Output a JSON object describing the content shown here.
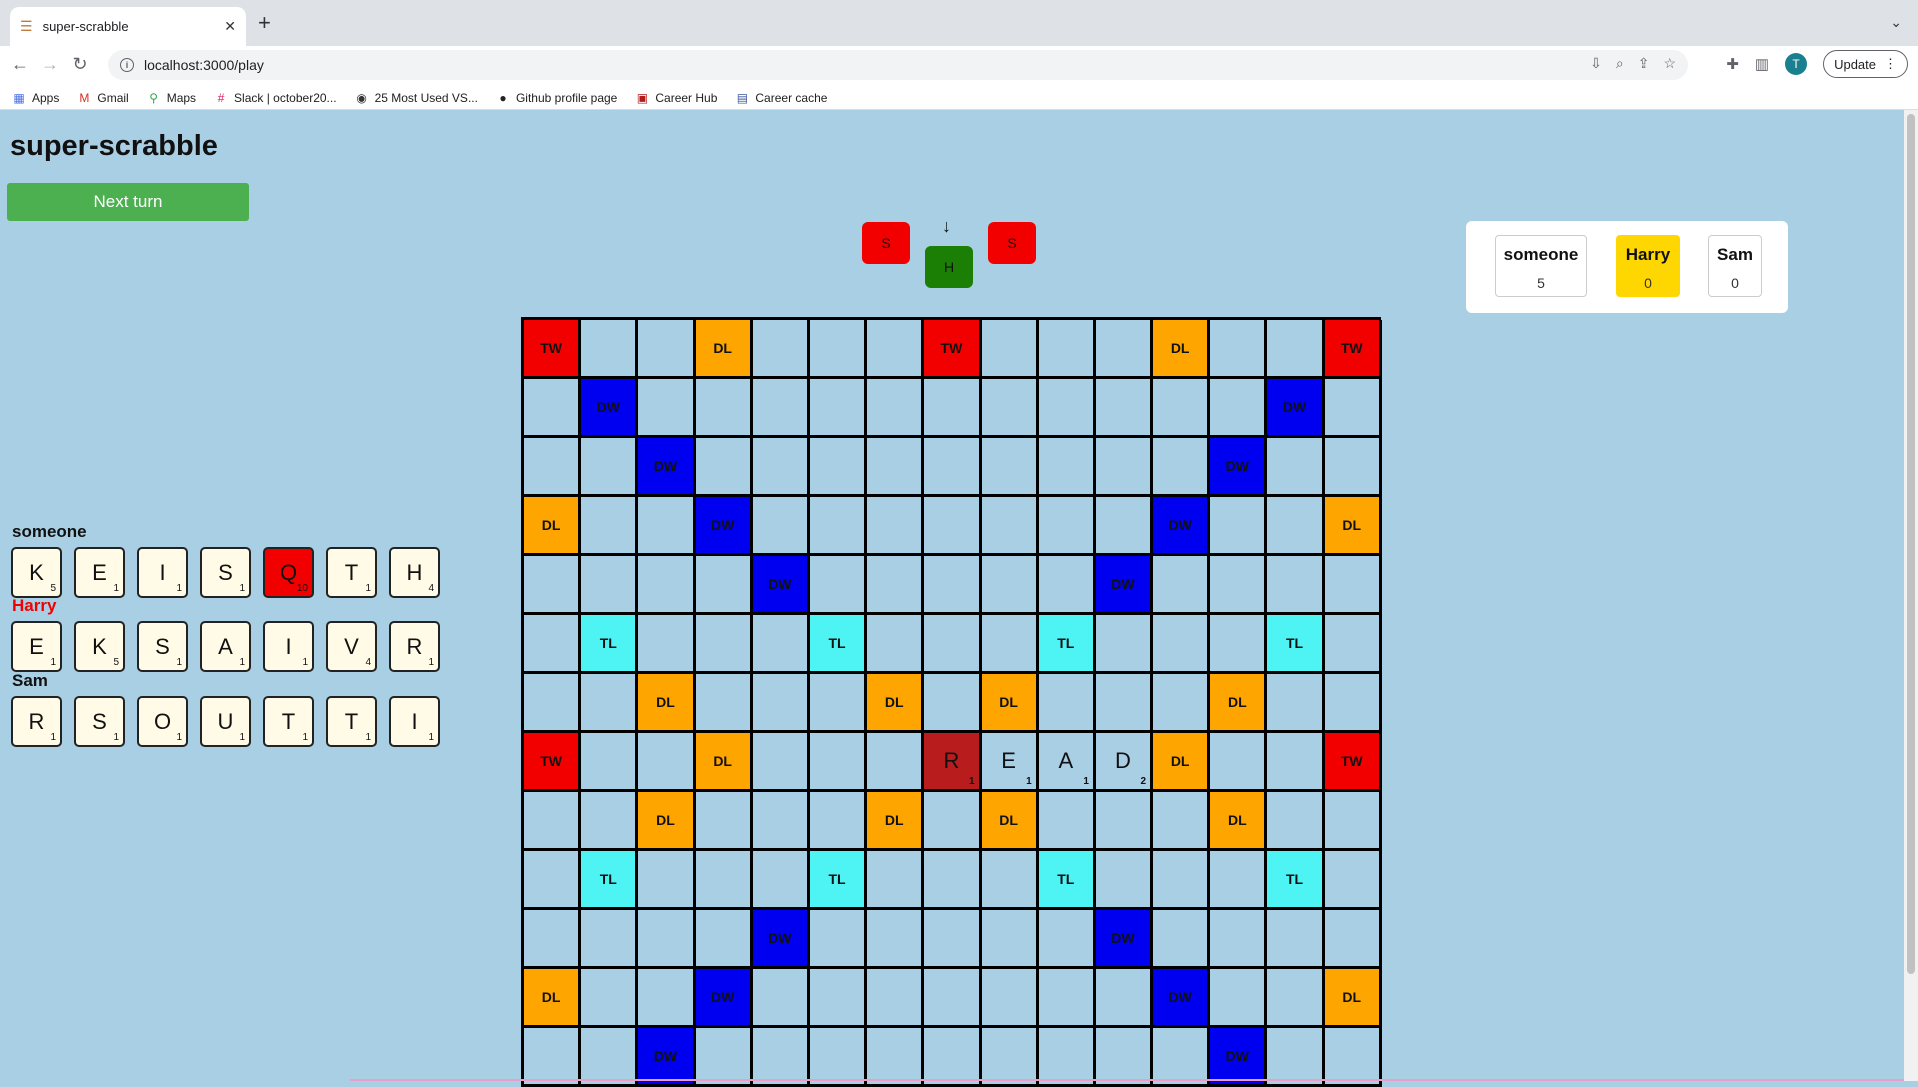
{
  "browser": {
    "tab_title": "super-scrabble",
    "url": "localhost:3000/play",
    "avatar_letter": "T",
    "update_label": "Update",
    "bookmarks": [
      {
        "label": "Apps",
        "icon": "apps-grid-icon"
      },
      {
        "label": "Gmail",
        "icon": "gmail-icon"
      },
      {
        "label": "Maps",
        "icon": "maps-pin-icon"
      },
      {
        "label": "Slack | october20...",
        "icon": "slack-icon"
      },
      {
        "label": "25 Most Used VS...",
        "icon": "vscode-icon"
      },
      {
        "label": "Github profile page",
        "icon": "github-icon"
      },
      {
        "label": "Career Hub",
        "icon": "career-hub-icon"
      },
      {
        "label": "Career cache",
        "icon": "career-cache-icon"
      }
    ]
  },
  "app": {
    "title": "super-scrabble",
    "next_turn_label": "Next turn"
  },
  "preview": {
    "tiles": [
      {
        "letter": "S",
        "color": "#f20000"
      },
      {
        "letter": "H",
        "color": "#1b7f05"
      },
      {
        "letter": "S",
        "color": "#f20000"
      }
    ]
  },
  "scoreboard": [
    {
      "name": "someone",
      "score": "5",
      "active": false
    },
    {
      "name": "Harry",
      "score": "0",
      "active": true
    },
    {
      "name": "Sam",
      "score": "0",
      "active": false
    }
  ],
  "board": {
    "rows": [
      [
        "TW",
        "",
        "",
        "DL",
        "",
        "",
        "",
        "TW",
        "",
        "",
        "",
        "DL",
        "",
        "",
        "TW"
      ],
      [
        "",
        "DW",
        "",
        "",
        "",
        "",
        "",
        "",
        "",
        "",
        "",
        "",
        "",
        "DW",
        ""
      ],
      [
        "",
        "",
        "DW",
        "",
        "",
        "",
        "",
        "",
        "",
        "",
        "",
        "",
        "DW",
        "",
        ""
      ],
      [
        "DL",
        "",
        "",
        "DW",
        "",
        "",
        "",
        "",
        "",
        "",
        "",
        "DW",
        "",
        "",
        "DL"
      ],
      [
        "",
        "",
        "",
        "",
        "DW",
        "",
        "",
        "",
        "",
        "",
        "DW",
        "",
        "",
        "",
        ""
      ],
      [
        "",
        "TL",
        "",
        "",
        "",
        "TL",
        "",
        "",
        "",
        "TL",
        "",
        "",
        "",
        "TL",
        ""
      ],
      [
        "",
        "",
        "DL",
        "",
        "",
        "",
        "DL",
        "",
        "DL",
        "",
        "",
        "",
        "DL",
        "",
        ""
      ],
      [
        "TW",
        "",
        "",
        "DL",
        "",
        "",
        "",
        "R|1",
        "E|1",
        "A|1",
        "D|2",
        "DL",
        "",
        "",
        "TW"
      ],
      [
        "",
        "",
        "DL",
        "",
        "",
        "",
        "DL",
        "",
        "DL",
        "",
        "",
        "",
        "DL",
        "",
        ""
      ],
      [
        "",
        "TL",
        "",
        "",
        "",
        "TL",
        "",
        "",
        "",
        "TL",
        "",
        "",
        "",
        "TL",
        ""
      ],
      [
        "",
        "",
        "",
        "",
        "DW",
        "",
        "",
        "",
        "",
        "",
        "DW",
        "",
        "",
        "",
        ""
      ],
      [
        "DL",
        "",
        "",
        "DW",
        "",
        "",
        "",
        "",
        "",
        "",
        "",
        "DW",
        "",
        "",
        "DL"
      ],
      [
        "",
        "",
        "DW",
        "",
        "",
        "",
        "",
        "",
        "",
        "",
        "",
        "",
        "DW",
        "",
        ""
      ]
    ]
  },
  "racks": [
    {
      "player": "someone",
      "color": "#111111",
      "tiles": [
        {
          "letter": "K",
          "pts": "5"
        },
        {
          "letter": "E",
          "pts": "1"
        },
        {
          "letter": "I",
          "pts": "1"
        },
        {
          "letter": "S",
          "pts": "1"
        },
        {
          "letter": "Q",
          "pts": "10",
          "special": true
        },
        {
          "letter": "T",
          "pts": "1"
        },
        {
          "letter": "H",
          "pts": "4"
        }
      ]
    },
    {
      "player": "Harry",
      "color": "#f20000",
      "tiles": [
        {
          "letter": "E",
          "pts": "1"
        },
        {
          "letter": "K",
          "pts": "5"
        },
        {
          "letter": "S",
          "pts": "1"
        },
        {
          "letter": "A",
          "pts": "1"
        },
        {
          "letter": "I",
          "pts": "1"
        },
        {
          "letter": "V",
          "pts": "4"
        },
        {
          "letter": "R",
          "pts": "1"
        }
      ]
    },
    {
      "player": "Sam",
      "color": "#111111",
      "tiles": [
        {
          "letter": "R",
          "pts": "1"
        },
        {
          "letter": "S",
          "pts": "1"
        },
        {
          "letter": "O",
          "pts": "1"
        },
        {
          "letter": "U",
          "pts": "1"
        },
        {
          "letter": "T",
          "pts": "1"
        },
        {
          "letter": "T",
          "pts": "1"
        },
        {
          "letter": "I",
          "pts": "1"
        }
      ]
    }
  ]
}
